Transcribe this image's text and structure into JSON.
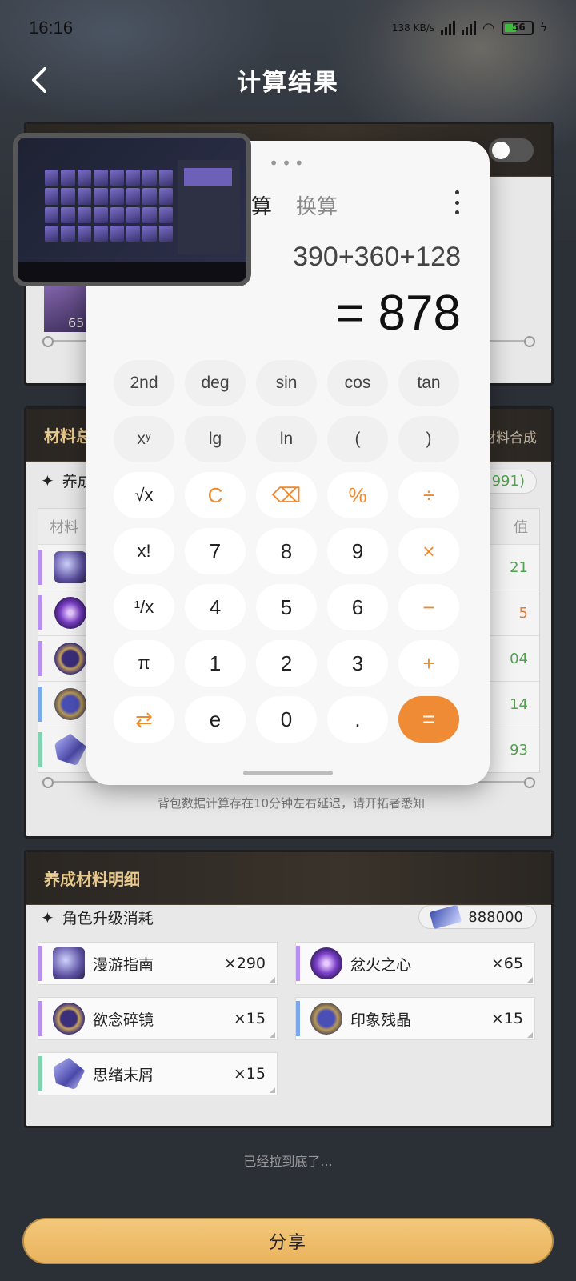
{
  "status": {
    "time": "16:16",
    "net_speed": "138 KB/s",
    "battery": "56"
  },
  "header": {
    "title": "计算结果"
  },
  "card2": {
    "title": "材料总",
    "right_label": "材料合成",
    "section_label": "养成",
    "pill_value": "991)",
    "table_headers": {
      "material": "材料",
      "value": "值"
    },
    "rows": [
      {
        "value": "21",
        "color": "#4fa34f",
        "bar": "purple",
        "icon": "book-icon"
      },
      {
        "value": "5",
        "color": "#e27a3a",
        "bar": "purple",
        "icon": "heart-icon"
      },
      {
        "value": "04",
        "color": "#4fa34f",
        "bar": "purple",
        "icon": "mirror-icon"
      },
      {
        "value": "14",
        "color": "#4fa34f",
        "bar": "blue",
        "icon": "crystal-icon"
      },
      {
        "value": "93",
        "color": "#4fa34f",
        "bar": "green",
        "icon": "shard-icon"
      }
    ],
    "footnote": "背包数据计算存在10分钟左右延迟，请开拓者悉知"
  },
  "card1": {
    "thumb_count": "65"
  },
  "card3": {
    "title": "养成材料明细",
    "section_label": "角色升级消耗",
    "credits": "888000",
    "items": [
      {
        "name": "漫游指南",
        "qty": "×290"
      },
      {
        "name": "忿火之心",
        "qty": "×65"
      },
      {
        "name": "欲念碎镜",
        "qty": "×15"
      },
      {
        "name": "印象残晶",
        "qty": "×15"
      },
      {
        "name": "思绪末屑",
        "qty": "×15"
      }
    ]
  },
  "bottom_note": "已经拉到底了...",
  "share_label": "分享",
  "calculator": {
    "dots": "•••",
    "tab_calc": "计算",
    "tab_convert": "换算",
    "expression": "390+360+128",
    "result": "= 878",
    "keys": [
      "2nd",
      "deg",
      "sin",
      "cos",
      "tan",
      "xʸ",
      "lg",
      "ln",
      "(",
      ")",
      "√x",
      "C",
      "⌫",
      "%",
      "÷",
      "x!",
      "7",
      "8",
      "9",
      "×",
      "¹/x",
      "4",
      "5",
      "6",
      "−",
      "π",
      "1",
      "2",
      "3",
      "+",
      "⇄",
      "e",
      "0",
      ".",
      "="
    ]
  }
}
